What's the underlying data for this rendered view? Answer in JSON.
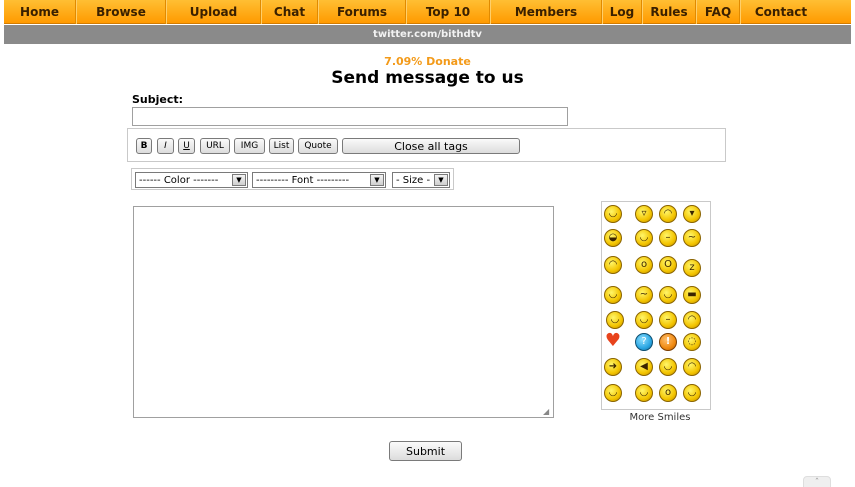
{
  "nav": {
    "items": [
      {
        "label": "Home",
        "width": 72
      },
      {
        "label": "Browse",
        "width": 90
      },
      {
        "label": "Upload",
        "width": 95
      },
      {
        "label": "Chat",
        "width": 57
      },
      {
        "label": "Forums",
        "width": 88
      },
      {
        "label": "Top 10",
        "width": 84
      },
      {
        "label": "Members",
        "width": 112
      },
      {
        "label": "Log",
        "width": 40
      },
      {
        "label": "Rules",
        "width": 54
      },
      {
        "label": "FAQ",
        "width": 44
      },
      {
        "label": "Contact",
        "width": 81
      }
    ]
  },
  "subbar": {
    "text": "twitter.com/bithdtv"
  },
  "donate": {
    "text": "7.09% Donate"
  },
  "page": {
    "title": "Send message to us"
  },
  "form": {
    "subject_label": "Subject:",
    "subject_value": "",
    "message_value": "",
    "submit_label": "Submit"
  },
  "toolbar": {
    "bold": "B",
    "italic": "I",
    "underline": "U",
    "url": "URL",
    "img": "IMG",
    "list": "List",
    "quote": "Quote",
    "close_tags": "Close all tags"
  },
  "selects": {
    "color": "------ Color -------",
    "font": "--------- Font ---------",
    "size": "- Size -"
  },
  "smilies": {
    "more_label": "More Smiles"
  },
  "colors": {
    "nav_top": "#ffbf33",
    "nav_bottom": "#ff9a00",
    "subbar": "#8a8a8a",
    "donate": "#f39a19"
  }
}
